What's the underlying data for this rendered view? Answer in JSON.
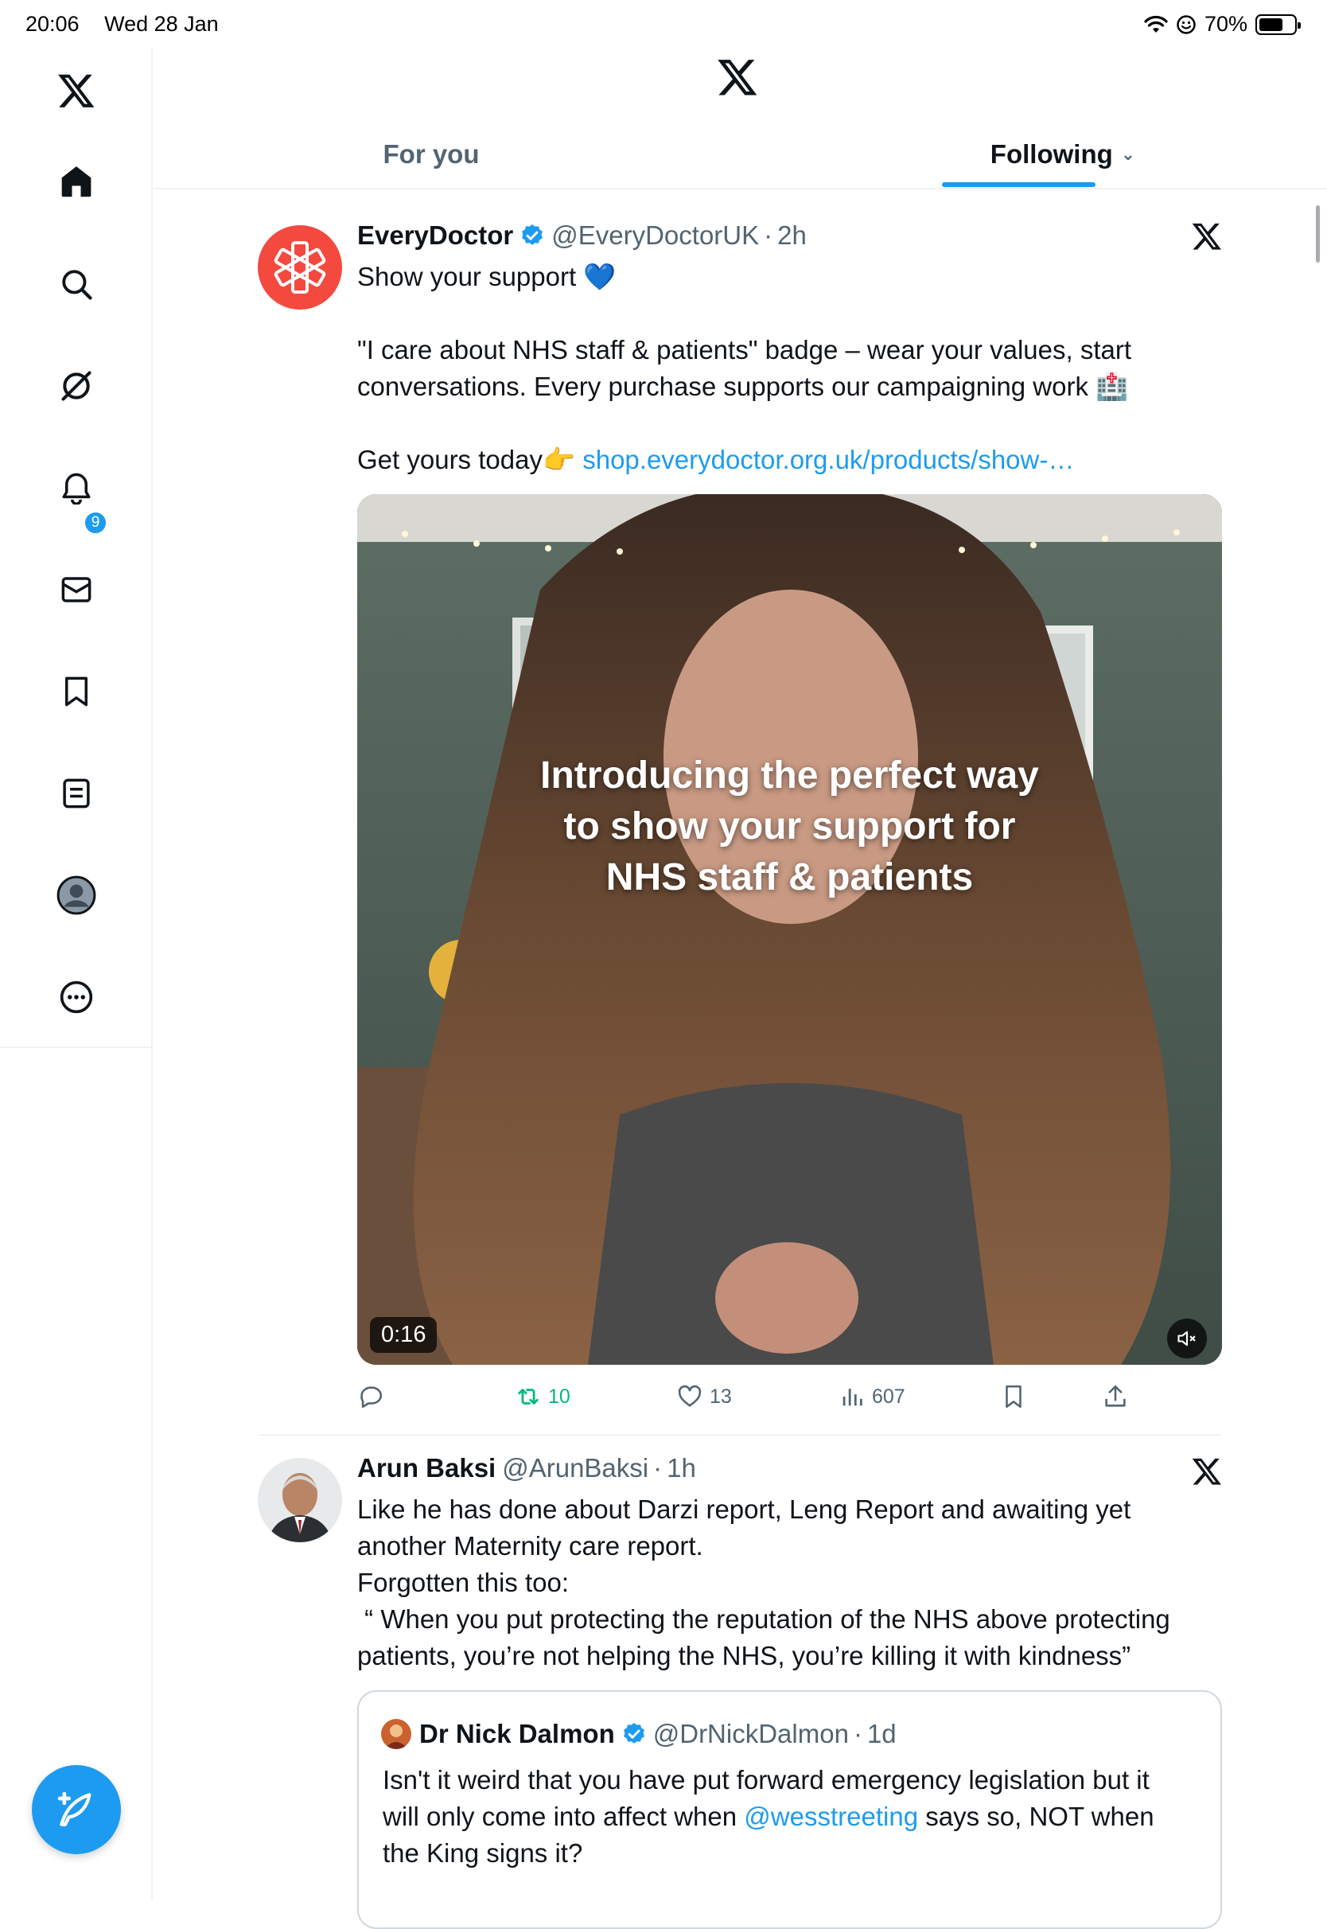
{
  "status_bar": {
    "time": "20:06",
    "date": "Wed 28 Jan",
    "battery": "70%"
  },
  "sidebar": {
    "items": [
      {
        "name": "home",
        "icon": "home-icon"
      },
      {
        "name": "explore",
        "icon": "search-icon"
      },
      {
        "name": "grok",
        "icon": "grok-icon"
      },
      {
        "name": "notifications",
        "icon": "bell-icon",
        "badge": "9"
      },
      {
        "name": "messages",
        "icon": "mail-icon"
      },
      {
        "name": "bookmarks",
        "icon": "bookmark-icon"
      },
      {
        "name": "lists",
        "icon": "list-icon"
      },
      {
        "name": "profile",
        "icon": "profile-icon"
      },
      {
        "name": "more",
        "icon": "more-icon"
      }
    ],
    "compose_icon": "compose-icon"
  },
  "tabs": {
    "for_you": "For you",
    "following": "Following"
  },
  "tweets": [
    {
      "name": "EveryDoctor",
      "handle": "@EveryDoctorUK",
      "sep": "·",
      "time": "2h",
      "lines": {
        "l1": "Show your support 💙",
        "l2": "\"I care about NHS staff & patients\" badge – wear your values, start",
        "l3": "conversations. Every purchase supports our campaigning work 🏥",
        "l4_pre": "Get yours today👉 ",
        "l4_link": "shop.everydoctor.org.uk/products/show-…"
      },
      "media": {
        "caption_1": "Introducing the perfect way",
        "caption_2": "to show your support for",
        "caption_3": "NHS staff & patients",
        "duration": "0:16"
      },
      "stats": {
        "reposts": "10",
        "likes": "13",
        "views": "607"
      }
    },
    {
      "name": "Arun Baksi",
      "handle": "@ArunBaksi",
      "sep": "·",
      "time": "1h",
      "lines": {
        "l1": "Like he has done about Darzi report, Leng Report and awaiting yet",
        "l2": "another Maternity care report.",
        "l3": "Forgotten this too:",
        "l4": " “ When you put protecting the reputation of the NHS above protecting",
        "l5": "patients, you’re not helping the NHS, you’re killing it with kindness”"
      },
      "quote": {
        "name": "Dr Nick Dalmon",
        "handle": "@DrNickDalmon",
        "sep": "·",
        "time": "1d",
        "l1": "Isn't it weird that you have put forward emergency legislation but it",
        "l2_pre": "will only come into affect when ",
        "l2_mention": "@wesstreeting",
        "l2_post": " says so, NOT when",
        "l3": "the King signs it?"
      }
    }
  ],
  "colors": {
    "accent": "#1d9bf0",
    "repost_active": "#00ba7c",
    "muted_text": "#536471",
    "everydoctor_red": "#f4493f"
  }
}
